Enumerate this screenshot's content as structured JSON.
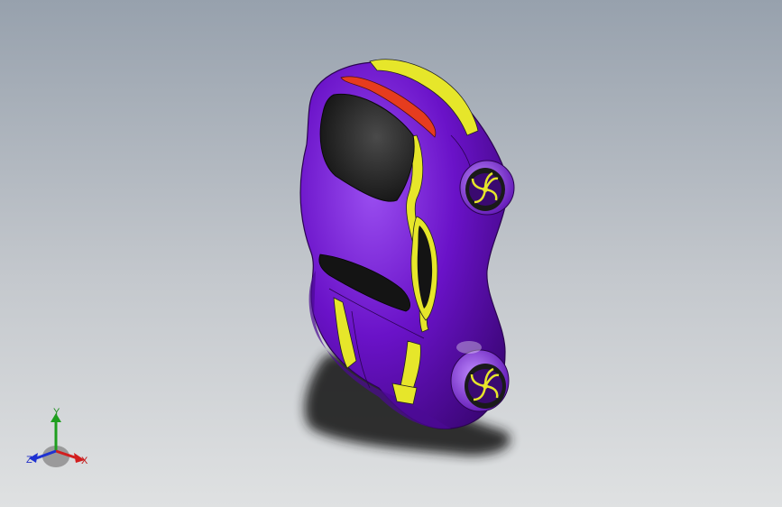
{
  "viewport": {
    "background_top": "#97a1ad",
    "background_bottom": "#dfe1e2"
  },
  "model": {
    "body_color": "#6a12c8",
    "stripe_color": "#e6e62a",
    "glass_color": "#1a1a1a",
    "taillight_color": "#e63c1e",
    "shadow_color": "#202020"
  },
  "triad": {
    "x_label": "X",
    "y_label": "Y",
    "z_label": "Z",
    "x_color": "#d21e1e",
    "y_color": "#1e9e1e",
    "z_color": "#1e32d2"
  }
}
